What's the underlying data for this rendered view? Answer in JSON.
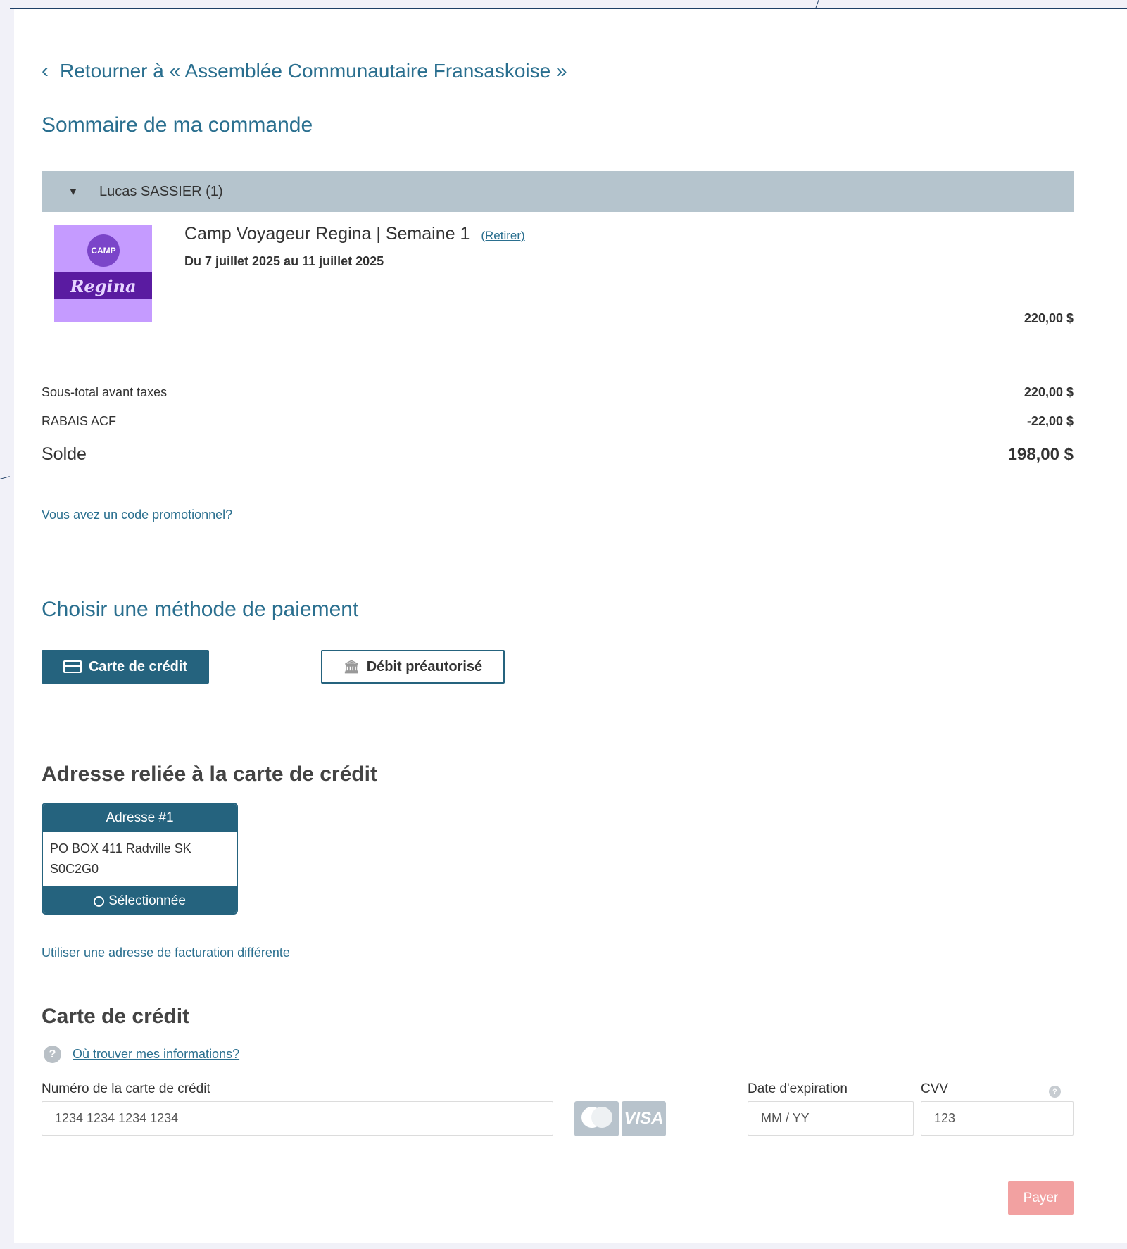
{
  "back_link": {
    "label": "Retourner à « Assemblée Communautaire Fransaskoise »"
  },
  "summary": {
    "title": "Sommaire de ma commande",
    "person": "Lucas SASSIER (1)",
    "item": {
      "thumb_stamp": "CAMP",
      "thumb_band": "Regina",
      "title": "Camp Voyageur Regina | Semaine 1",
      "remove_label": "(Retirer)",
      "dates": "Du 7 juillet 2025 au 11 juillet 2025",
      "price": "220,00 $"
    },
    "subtotal_label": "Sous-total avant taxes",
    "subtotal_value": "220,00 $",
    "discount_label": "RABAIS ACF",
    "discount_value": "-22,00 $",
    "balance_label": "Solde",
    "balance_value": "198,00 $",
    "promo_link": "Vous avez un code promotionnel?"
  },
  "payment_method": {
    "title": "Choisir une méthode de paiement",
    "credit_label": "Carte de crédit",
    "debit_label": "Débit préautorisé"
  },
  "address": {
    "title": "Adresse reliée à la carte de crédit",
    "card_title": "Adresse #1",
    "line1": "PO BOX 411 Radville SK",
    "line2": "S0C2G0",
    "selected_label": "Sélectionnée",
    "other_link": "Utiliser une adresse de facturation différente"
  },
  "credit_card": {
    "title": "Carte de crédit",
    "help_link": "Où trouver mes informations?",
    "number_label": "Numéro de la carte de crédit",
    "number_placeholder": "1234 1234 1234 1234",
    "expiry_label": "Date d'expiration",
    "expiry_placeholder": "MM / YY",
    "cvv_label": "CVV",
    "cvv_placeholder": "123",
    "visa_label": "VISA"
  },
  "pay_button": "Payer",
  "colors": {
    "primary": "#25637e",
    "link": "#2a6f8f",
    "person_bar": "#b5c4cd",
    "pay_disabled": "#f2a1a1"
  }
}
